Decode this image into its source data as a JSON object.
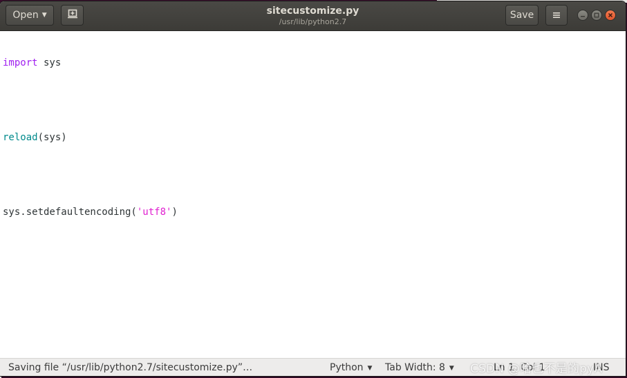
{
  "header": {
    "open_label": "Open",
    "save_label": "Save",
    "title": "sitecustomize.py",
    "subtitle": "/usr/lib/python2.7"
  },
  "icons": {
    "open_caret": "chevron-down-icon",
    "new_document": "new-document-icon",
    "menu": "hamburger-menu-icon",
    "minimize": "minimize-icon",
    "maximize": "maximize-icon",
    "close": "close-icon"
  },
  "editor": {
    "lines": [
      {
        "t1": "import",
        "t2": " sys",
        "t3": "",
        "t4": "",
        "t5": ""
      },
      {
        "t1": "",
        "t2": "",
        "t3": "",
        "t4": "",
        "t5": ""
      },
      {
        "t1": "reload",
        "t2": "(sys)",
        "t3": "",
        "t4": "",
        "t5": ""
      },
      {
        "t1": "",
        "t2": "",
        "t3": "",
        "t4": "",
        "t5": ""
      },
      {
        "t1": "sys.setdefaultencoding(",
        "t2": "'utf8'",
        "t3": ")",
        "t4": "",
        "t5": ""
      }
    ]
  },
  "statusbar": {
    "message": "Saving file “/usr/lib/python2.7/sitecustomize.py”…",
    "language": "Python",
    "tab_width": "Tab Width: 8",
    "position": "Ln 1, Col 1",
    "mode": "INS"
  },
  "watermark": {
    "text": "CSDN @哈也不是的pyA"
  },
  "colors": {
    "keyword": "#a020f0",
    "builtin": "#008a8c",
    "string": "#e020d0",
    "headerbar": "#3c3b37",
    "close_button": "#e0542c"
  }
}
